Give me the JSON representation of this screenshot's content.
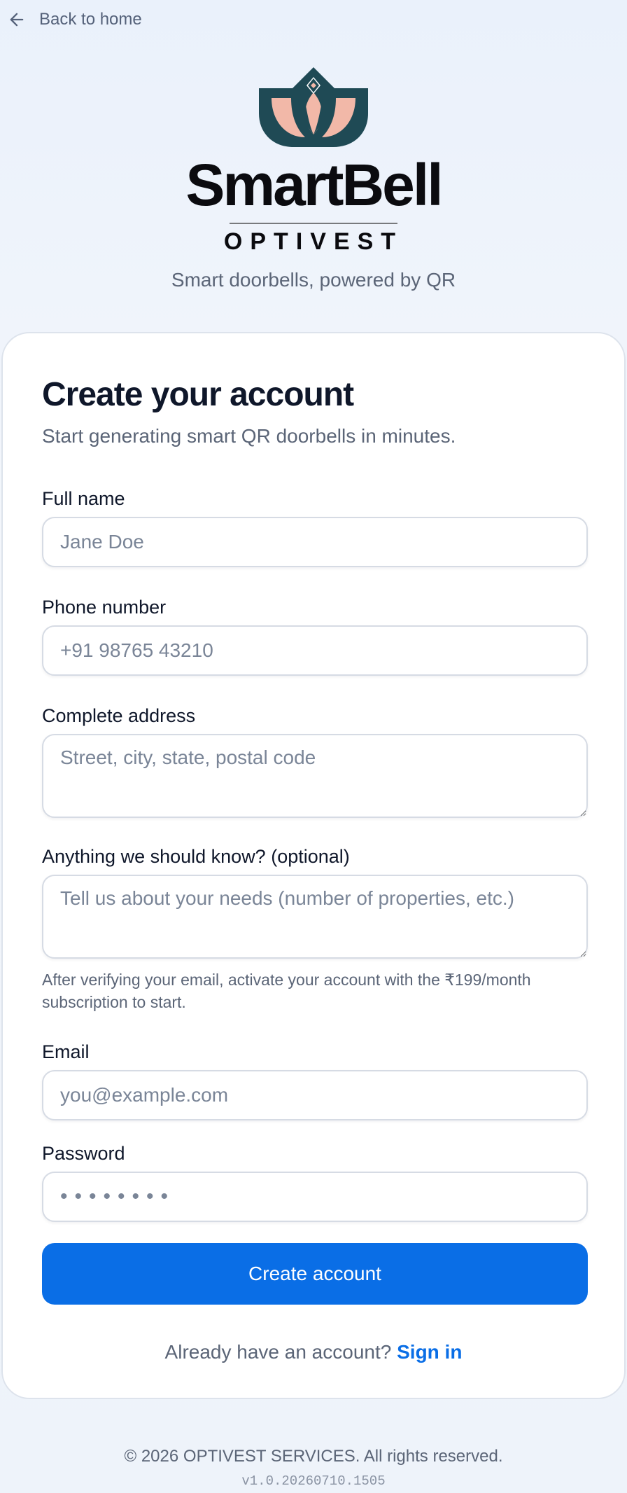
{
  "nav": {
    "back_label": "Back to home"
  },
  "brand": {
    "name": "SmartBell",
    "company": "OPTIVEST",
    "tagline": "Smart doorbells, powered by QR",
    "logo_icon": "lotus-logo-icon",
    "colors": {
      "dark_teal": "#1f4a55",
      "peach": "#f2b8a8"
    }
  },
  "form": {
    "title": "Create your account",
    "subtitle": "Start generating smart QR doorbells in minutes.",
    "fields": {
      "full_name": {
        "label": "Full name",
        "placeholder": "Jane Doe"
      },
      "phone": {
        "label": "Phone number",
        "placeholder": "+91 98765 43210"
      },
      "address": {
        "label": "Complete address",
        "placeholder": "Street, city, state, postal code"
      },
      "notes": {
        "label": "Anything we should know? (optional)",
        "placeholder": "Tell us about your needs (number of properties, etc.)"
      },
      "email": {
        "label": "Email",
        "placeholder": "you@example.com"
      },
      "password": {
        "label": "Password",
        "placeholder": "••••••••"
      }
    },
    "hint": "After verifying your email, activate your account with the ₹199/month subscription to start.",
    "submit_label": "Create account",
    "signin_prompt": "Already have an account?",
    "signin_link": "Sign in"
  },
  "footer": {
    "copyright": "© 2026 OPTIVEST SERVICES. All rights reserved.",
    "version": "v1.0.20260710.1505"
  },
  "colors": {
    "accent": "#0a6ee6",
    "muted_text": "#5b6577"
  }
}
